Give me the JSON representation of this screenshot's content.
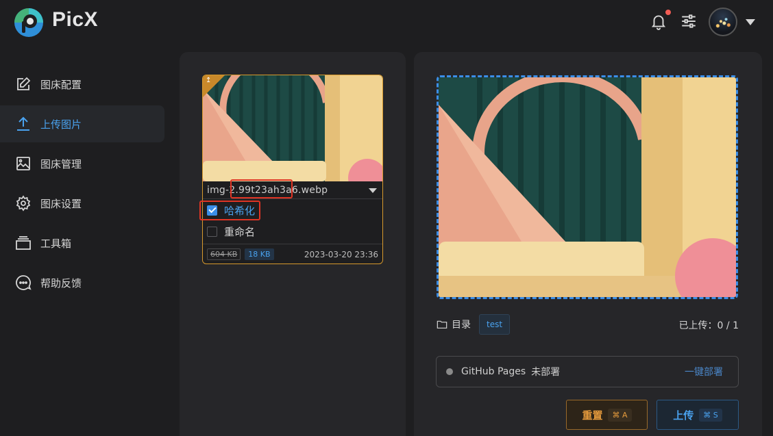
{
  "app": {
    "title": "PicX"
  },
  "header": {
    "notification_icon": "bell-icon",
    "settings_icon": "sliders-icon",
    "avatar_icon": "avatar",
    "accent": "#f25c54"
  },
  "sidebar": {
    "items": [
      {
        "label": "图床配置",
        "icon": "edit-icon",
        "active": false
      },
      {
        "label": "上传图片",
        "icon": "upload-icon",
        "active": true
      },
      {
        "label": "图床管理",
        "icon": "image-icon",
        "active": false
      },
      {
        "label": "图床设置",
        "icon": "gear-icon",
        "active": false
      },
      {
        "label": "工具箱",
        "icon": "toolbox-icon",
        "active": false
      },
      {
        "label": "帮助反馈",
        "icon": "chat-icon",
        "active": false
      }
    ]
  },
  "upload_card": {
    "file_name": "img-2.99t23ah3a6.webp",
    "options": [
      {
        "label": "哈希化",
        "checked": true
      },
      {
        "label": "重命名",
        "checked": false
      }
    ],
    "original_size": "604 KB",
    "compressed_size": "18 KB",
    "timestamp": "2023-03-20 23:36"
  },
  "preview": {
    "directory_label": "目录",
    "directory_value": "test",
    "uploaded_text": "已上传：0 / 1"
  },
  "deploy": {
    "name": "GitHub Pages",
    "status": "未部署",
    "action": "一键部署"
  },
  "actions": {
    "reset_label": "重置",
    "reset_shortcut": "⌘ A",
    "upload_label": "上传",
    "upload_shortcut": "⌘ S"
  },
  "colors": {
    "accent_blue": "#4aa3f0",
    "warning_orange": "#e49a3c",
    "highlight_red": "#e03424"
  }
}
